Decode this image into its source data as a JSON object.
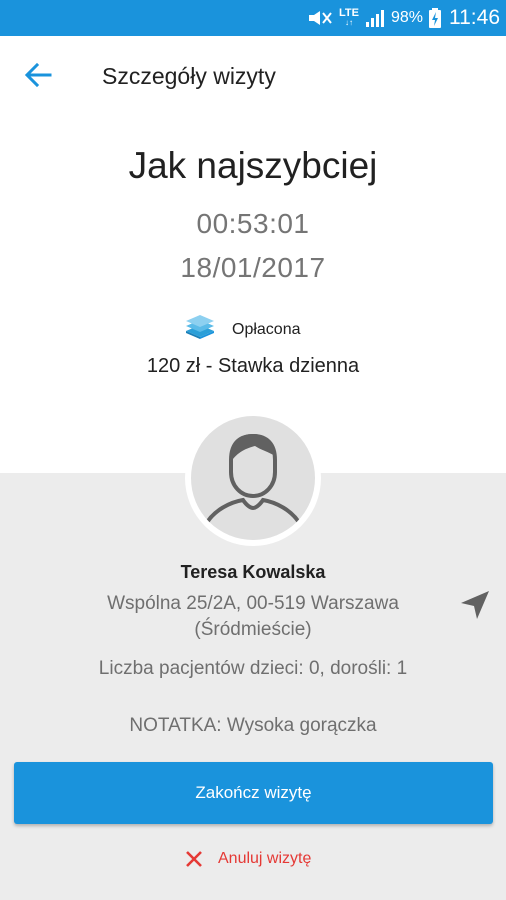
{
  "status_bar": {
    "network": "LTE",
    "battery": "98%",
    "time": "11:46"
  },
  "toolbar": {
    "title": "Szczegóły wizyty"
  },
  "visit": {
    "headline": "Jak najszybciej",
    "time": "00:53:01",
    "date": "18/01/2017",
    "payment_status": "Opłacona",
    "rate": "120 zł - Stawka dzienna"
  },
  "patient": {
    "name": "Teresa Kowalska",
    "address_line1": "Wspólna 25/2A, 00-519 Warszawa",
    "address_line2": "(Śródmieście)",
    "patients_count": "Liczba pacjentów dzieci: 0, dorośli: 1",
    "note": "NOTATKA: Wysoka gorączka"
  },
  "actions": {
    "finish_label": "Zakończ wizytę",
    "cancel_label": "Anuluj wizytę"
  },
  "colors": {
    "accent": "#1a93dc",
    "danger": "#e53935",
    "panel": "#ececec"
  }
}
